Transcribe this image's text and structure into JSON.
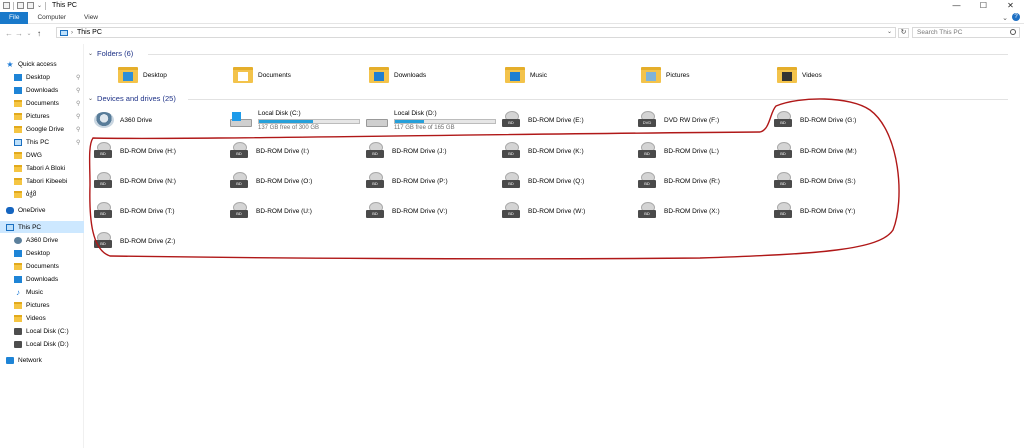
{
  "window": {
    "title": "This PC",
    "controls": {
      "minimize": "—",
      "maximize": "☐",
      "close": "✕"
    }
  },
  "ribbon": {
    "tabs": [
      "File",
      "Computer",
      "View"
    ],
    "expand_icon": "chevron-down-icon",
    "help_icon": "?"
  },
  "nav": {
    "back": "←",
    "forward": "→",
    "recent": "⌄",
    "up": "↑",
    "path": "This PC",
    "address_chevron": "›",
    "dropdown": "⌄",
    "refresh": "↻",
    "search_placeholder": "Search This PC"
  },
  "sidebar": {
    "items": [
      {
        "label": "Quick access",
        "icon": "star-icon",
        "pinned": false,
        "selected": false
      },
      {
        "label": "Desktop",
        "icon": "desktop-icon",
        "pinned": true,
        "selected": false
      },
      {
        "label": "Downloads",
        "icon": "downloads-icon",
        "pinned": true,
        "selected": false
      },
      {
        "label": "Documents",
        "icon": "documents-icon",
        "pinned": true,
        "selected": false
      },
      {
        "label": "Pictures",
        "icon": "pictures-icon",
        "pinned": true,
        "selected": false
      },
      {
        "label": "Google Drive",
        "icon": "google-drive-icon",
        "pinned": true,
        "selected": false
      },
      {
        "label": "This PC",
        "icon": "pc-icon",
        "pinned": true,
        "selected": false
      },
      {
        "label": "DWG",
        "icon": "folder-icon",
        "pinned": false,
        "selected": false
      },
      {
        "label": "Tabori A Bloki",
        "icon": "folder-icon",
        "pinned": false,
        "selected": false
      },
      {
        "label": "Tabori Kibeebi",
        "icon": "folder-icon",
        "pinned": false,
        "selected": false
      },
      {
        "label": "ბჭმ",
        "icon": "folder-icon",
        "pinned": false,
        "selected": false
      },
      {
        "label": "OneDrive",
        "icon": "onedrive-icon",
        "pinned": false,
        "selected": false
      },
      {
        "label": "This PC",
        "icon": "pc-icon",
        "pinned": false,
        "selected": true
      },
      {
        "label": "A360 Drive",
        "icon": "a360-icon",
        "pinned": false,
        "selected": false
      },
      {
        "label": "Desktop",
        "icon": "desktop-icon",
        "pinned": false,
        "selected": false
      },
      {
        "label": "Documents",
        "icon": "documents-icon",
        "pinned": false,
        "selected": false
      },
      {
        "label": "Downloads",
        "icon": "downloads-icon",
        "pinned": false,
        "selected": false
      },
      {
        "label": "Music",
        "icon": "music-icon",
        "pinned": false,
        "selected": false
      },
      {
        "label": "Pictures",
        "icon": "pictures-icon",
        "pinned": false,
        "selected": false
      },
      {
        "label": "Videos",
        "icon": "videos-icon",
        "pinned": false,
        "selected": false
      },
      {
        "label": "Local Disk (C:)",
        "icon": "local-disk-icon",
        "pinned": false,
        "selected": false
      },
      {
        "label": "Local Disk (D:)",
        "icon": "local-disk-icon",
        "pinned": false,
        "selected": false
      },
      {
        "label": "Network",
        "icon": "network-icon",
        "pinned": false,
        "selected": false
      }
    ],
    "pin_glyph": "📌"
  },
  "folders": {
    "header": "Folders (6)",
    "items": [
      {
        "label": "Desktop",
        "icon": "desktop-folder-icon"
      },
      {
        "label": "Documents",
        "icon": "documents-folder-icon"
      },
      {
        "label": "Downloads",
        "icon": "downloads-folder-icon"
      },
      {
        "label": "Music",
        "icon": "music-folder-icon"
      },
      {
        "label": "Pictures",
        "icon": "pictures-folder-icon"
      },
      {
        "label": "Videos",
        "icon": "videos-folder-icon"
      }
    ]
  },
  "drives": {
    "header": "Devices and drives (25)",
    "items": [
      {
        "label": "A360 Drive",
        "kind": "a360"
      },
      {
        "label": "Local Disk (C:)",
        "kind": "hdd",
        "used_fraction": 0.54,
        "sub": "137 GB free of 300 GB"
      },
      {
        "label": "Local Disk (D:)",
        "kind": "hdd",
        "used_fraction": 0.29,
        "sub": "117 GB free of 165 GB"
      },
      {
        "label": "BD-ROM Drive (E:)",
        "kind": "bd",
        "tag": "BD"
      },
      {
        "label": "DVD RW Drive (F:)",
        "kind": "dvd",
        "tag": "DVD"
      },
      {
        "label": "BD-ROM Drive (G:)",
        "kind": "bd",
        "tag": "BD"
      },
      {
        "label": "BD-ROM Drive (H:)",
        "kind": "bd",
        "tag": "BD"
      },
      {
        "label": "BD-ROM Drive (I:)",
        "kind": "bd",
        "tag": "BD"
      },
      {
        "label": "BD-ROM Drive (J:)",
        "kind": "bd",
        "tag": "BD"
      },
      {
        "label": "BD-ROM Drive (K:)",
        "kind": "bd",
        "tag": "BD"
      },
      {
        "label": "BD-ROM Drive (L:)",
        "kind": "bd",
        "tag": "BD"
      },
      {
        "label": "BD-ROM Drive (M:)",
        "kind": "bd",
        "tag": "BD"
      },
      {
        "label": "BD-ROM Drive (N:)",
        "kind": "bd",
        "tag": "BD"
      },
      {
        "label": "BD-ROM Drive (O:)",
        "kind": "bd",
        "tag": "BD"
      },
      {
        "label": "BD-ROM Drive (P:)",
        "kind": "bd",
        "tag": "BD"
      },
      {
        "label": "BD-ROM Drive (Q:)",
        "kind": "bd",
        "tag": "BD"
      },
      {
        "label": "BD-ROM Drive (R:)",
        "kind": "bd",
        "tag": "BD"
      },
      {
        "label": "BD-ROM Drive (S:)",
        "kind": "bd",
        "tag": "BD"
      },
      {
        "label": "BD-ROM Drive (T:)",
        "kind": "bd",
        "tag": "BD"
      },
      {
        "label": "BD-ROM Drive (U:)",
        "kind": "bd",
        "tag": "BD"
      },
      {
        "label": "BD-ROM Drive (V:)",
        "kind": "bd",
        "tag": "BD"
      },
      {
        "label": "BD-ROM Drive (W:)",
        "kind": "bd",
        "tag": "BD"
      },
      {
        "label": "BD-ROM Drive (X:)",
        "kind": "bd",
        "tag": "BD"
      },
      {
        "label": "BD-ROM Drive (Y:)",
        "kind": "bd",
        "tag": "BD"
      },
      {
        "label": "BD-ROM Drive (Z:)",
        "kind": "bd",
        "tag": "BD"
      }
    ]
  },
  "colors": {
    "accent": "#1979ca",
    "selection": "#cde8ff",
    "group_header": "#1e3287",
    "usage_bar": "#26a0da",
    "annotation": "#b01818"
  }
}
